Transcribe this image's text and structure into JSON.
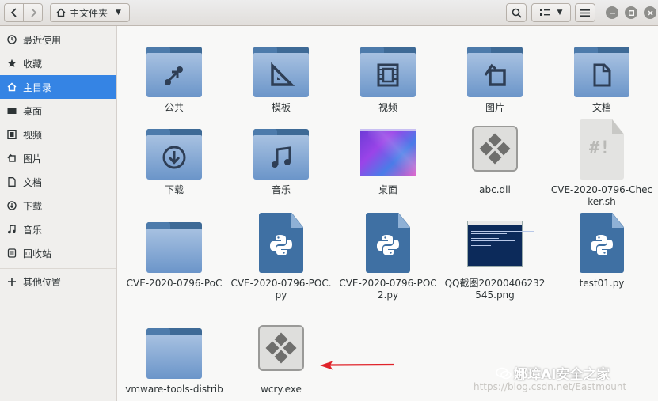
{
  "header": {
    "location_label": "主文件夹",
    "icons": [
      "go-back-icon",
      "go-forward-icon",
      "home-icon",
      "search-icon",
      "view-options-icon",
      "menu-icon",
      "minimize-icon",
      "maximize-icon",
      "close-icon"
    ]
  },
  "sidebar": {
    "items": [
      {
        "label": "最近使用",
        "icon": "recent-icon"
      },
      {
        "label": "收藏",
        "icon": "star-icon"
      },
      {
        "label": "主目录",
        "icon": "home-icon",
        "active": true
      },
      {
        "label": "桌面",
        "icon": "desktop-icon"
      },
      {
        "label": "视频",
        "icon": "video-icon"
      },
      {
        "label": "图片",
        "icon": "picture-icon"
      },
      {
        "label": "文档",
        "icon": "document-icon"
      },
      {
        "label": "下载",
        "icon": "download-icon"
      },
      {
        "label": "音乐",
        "icon": "music-icon"
      },
      {
        "label": "回收站",
        "icon": "trash-icon"
      },
      {
        "label": "其他位置",
        "icon": "plus-icon"
      }
    ]
  },
  "files": [
    {
      "name": "公共",
      "kind": "folder",
      "emblem": "share-icon"
    },
    {
      "name": "模板",
      "kind": "folder",
      "emblem": "template-icon"
    },
    {
      "name": "视频",
      "kind": "folder",
      "emblem": "video-icon"
    },
    {
      "name": "图片",
      "kind": "folder",
      "emblem": "picture-icon"
    },
    {
      "name": "文档",
      "kind": "folder",
      "emblem": "document-icon"
    },
    {
      "name": "下载",
      "kind": "folder",
      "emblem": "download-icon"
    },
    {
      "name": "音乐",
      "kind": "folder",
      "emblem": "music-icon"
    },
    {
      "name": "桌面",
      "kind": "desktop-thumbnail"
    },
    {
      "name": "abc.dll",
      "kind": "binary"
    },
    {
      "name": "CVE-2020-0796-Checker.sh",
      "kind": "shell-script"
    },
    {
      "name": "CVE-2020-0796-PoC",
      "kind": "folder"
    },
    {
      "name": "CVE-2020-0796-POC.py",
      "kind": "python"
    },
    {
      "name": "CVE-2020-0796-POC2.py",
      "kind": "python"
    },
    {
      "name": "QQ截图20200406232545.png",
      "kind": "image-thumbnail"
    },
    {
      "name": "test01.py",
      "kind": "python"
    },
    {
      "name": "vmware-tools-distrib",
      "kind": "folder"
    },
    {
      "name": "wcry.exe",
      "kind": "binary"
    }
  ],
  "watermark": {
    "title": "娜璋AI安全之家",
    "url": "https://blog.csdn.net/Eastmount"
  },
  "colors": {
    "accent": "#3584e4",
    "folder_front": "#7ea2d0",
    "folder_back": "#3e6a96",
    "arrow": "#e0232a"
  }
}
